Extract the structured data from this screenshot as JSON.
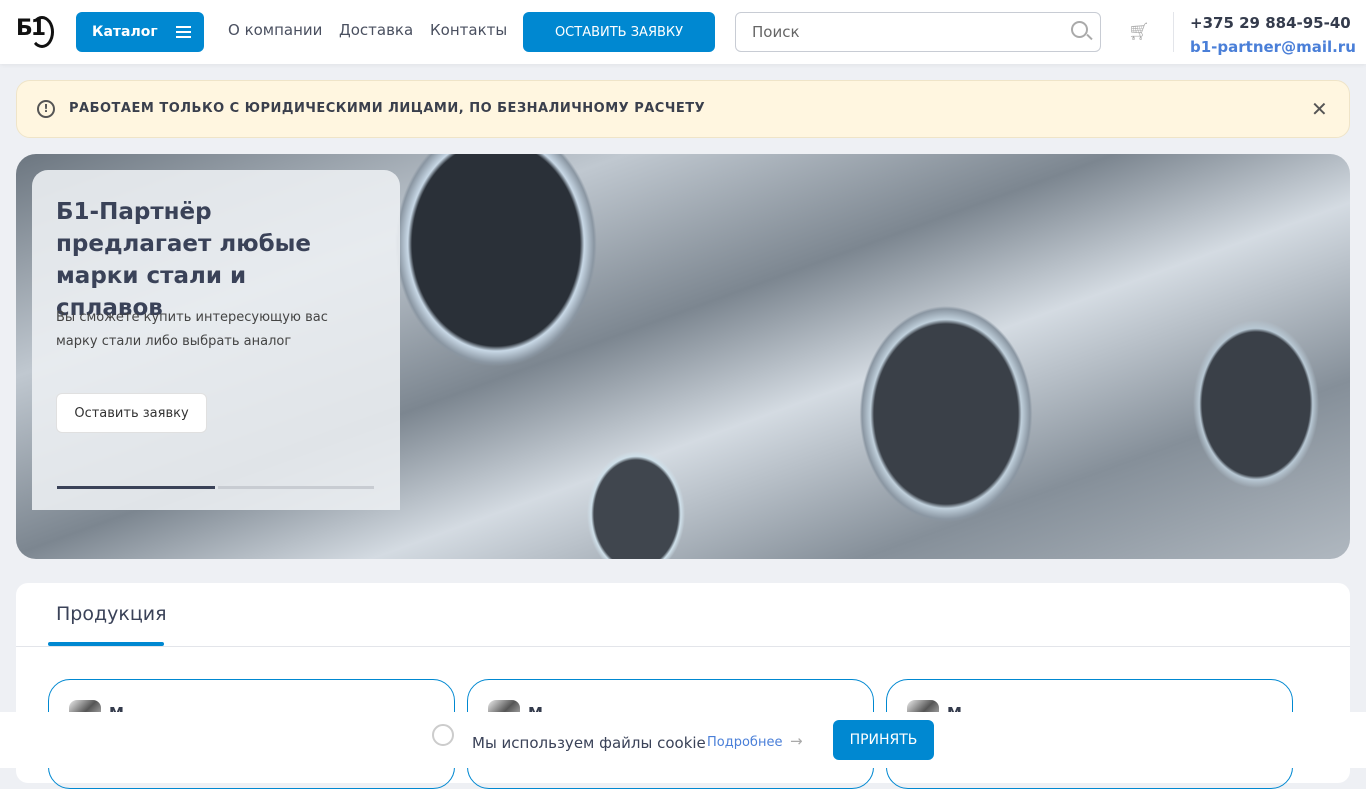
{
  "header": {
    "logo": "Б1",
    "catalog": "Каталог",
    "nav": [
      "О компании",
      "Доставка",
      "Контакты"
    ],
    "order_button": "ОСТАВИТЬ ЗАЯВКУ",
    "search_placeholder": "Поиск",
    "phone": "+375 29 884-95-40",
    "email": "b1-partner@mail.ru"
  },
  "notice": {
    "text": "РАБОТАЕМ ТОЛЬКО С ЮРИДИЧЕСКИМИ ЛИЦАМИ, ПО БЕЗНАЛИЧНОМУ РАСЧЕТУ"
  },
  "hero": {
    "title": "Б1-Партнёр предлагает любые марки стали и сплавов",
    "text": "Вы сможете купить интересующую вас марку стали либо выбрать аналог",
    "button": "Оставить заявку",
    "slide": 1,
    "slides": 2
  },
  "products": {
    "tab": "Продукция",
    "cards": [
      "М",
      "М",
      "М"
    ]
  },
  "cookie": {
    "text": "Мы используем файлы cookie",
    "more": "Подробнее",
    "accept": "ПРИНЯТЬ"
  },
  "colors": {
    "accent": "#0088d1"
  }
}
